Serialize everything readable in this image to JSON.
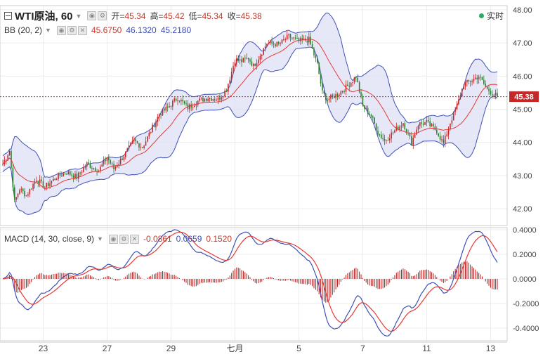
{
  "header": {
    "symbol": "WTI原油, 60",
    "ohlc": [
      {
        "label": "开=",
        "value": "45.34"
      },
      {
        "label": "高=",
        "value": "45.42"
      },
      {
        "label": "低=",
        "value": "45.34"
      },
      {
        "label": "收=",
        "value": "45.38"
      }
    ],
    "live_label": "实时"
  },
  "bb": {
    "label": "BB (20, 2)",
    "values": [
      "45.6750",
      "46.1320",
      "45.2180"
    ]
  },
  "macd": {
    "label": "MACD (14, 30, close, 9)",
    "values": [
      "-0.0861",
      "0.0659",
      "0.1520"
    ]
  },
  "chart_data": [
    {
      "type": "candlestick",
      "title": "",
      "x_tick_labels": [
        "23",
        "27",
        "29",
        "七月",
        "5",
        "7",
        "11",
        "13"
      ],
      "y_tick_labels": [
        "42.00",
        "43.00",
        "44.00",
        "45.00",
        "46.00",
        "47.00",
        "48.00"
      ],
      "ylim": [
        41.45,
        48.1
      ],
      "current_price_label": "45.38",
      "current_price": 45.38,
      "colors": {
        "up": "#c62828",
        "down": "#2e7d32",
        "ma": "#e53935",
        "band": "#3f51b5",
        "band_fill": "#dde0f5",
        "price_line": "#c62828"
      },
      "close_trajectory": [
        [
          0,
          43.35
        ],
        [
          4,
          43.75
        ],
        [
          7,
          42.2
        ],
        [
          10,
          42.6
        ],
        [
          14,
          42.4
        ],
        [
          20,
          42.9
        ],
        [
          25,
          42.65
        ],
        [
          32,
          42.95
        ],
        [
          38,
          43.1
        ],
        [
          44,
          42.95
        ],
        [
          50,
          43.35
        ],
        [
          57,
          43.15
        ],
        [
          62,
          43.55
        ],
        [
          66,
          43.2
        ],
        [
          72,
          43.6
        ],
        [
          78,
          44.05
        ],
        [
          83,
          43.85
        ],
        [
          88,
          44.35
        ],
        [
          93,
          44.85
        ],
        [
          98,
          45.05
        ],
        [
          104,
          45.35
        ],
        [
          110,
          45.05
        ],
        [
          116,
          45.25
        ],
        [
          122,
          45.35
        ],
        [
          128,
          45.3
        ],
        [
          133,
          45.6
        ],
        [
          138,
          46.5
        ],
        [
          142,
          46.45
        ],
        [
          146,
          46.55
        ],
        [
          149,
          46.3
        ],
        [
          152,
          46.55
        ],
        [
          157,
          47.0
        ],
        [
          164,
          46.95
        ],
        [
          170,
          47.2
        ],
        [
          176,
          47.05
        ],
        [
          182,
          47.1
        ],
        [
          187,
          46.35
        ],
        [
          190,
          45.5
        ],
        [
          193,
          45.3
        ],
        [
          199,
          45.45
        ],
        [
          205,
          45.7
        ],
        [
          210,
          46.0
        ],
        [
          214,
          45.1
        ],
        [
          219,
          44.8
        ],
        [
          223,
          44.3
        ],
        [
          227,
          44.05
        ],
        [
          232,
          44.3
        ],
        [
          238,
          44.6
        ],
        [
          243,
          44.0
        ],
        [
          247,
          44.55
        ],
        [
          252,
          44.6
        ],
        [
          258,
          44.35
        ],
        [
          262,
          43.95
        ],
        [
          266,
          44.6
        ],
        [
          270,
          45.1
        ],
        [
          274,
          45.75
        ],
        [
          278,
          45.85
        ],
        [
          283,
          46.0
        ],
        [
          288,
          45.6
        ],
        [
          292,
          45.45
        ],
        [
          294,
          45.38
        ]
      ]
    },
    {
      "type": "macd",
      "title": "",
      "y_tick_labels": [
        "0.4000",
        "0.2000",
        "0.0000",
        "-0.2000",
        "-0.4000"
      ],
      "ylim": [
        -0.49,
        0.42
      ],
      "colors": {
        "macd": "#3f51b5",
        "signal": "#e53935",
        "histogram": "#b71c1c"
      }
    }
  ]
}
